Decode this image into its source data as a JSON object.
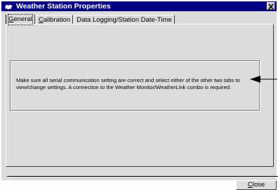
{
  "window": {
    "title": "Weather Station Properties",
    "title_icon": "weather-station-icon",
    "close_glyph": "✕"
  },
  "tabs": [
    {
      "label_first": "G",
      "label_rest": "eneral",
      "active": true
    },
    {
      "label_first": "C",
      "label_rest": "alibration",
      "active": false
    },
    {
      "label_first": "",
      "label_rest": "Data Logging/Station Date-Time",
      "active": false
    }
  ],
  "general": {
    "message": "Make sure all serial communication setting are correct and select either of the other two tabs to view/change settings. A connection to the Weather Monitor/WeatherLink combo is required."
  },
  "footer": {
    "close_first": "C",
    "close_rest": "lose"
  },
  "colors": {
    "titlebar": "#000080",
    "face": "#dcdcdc"
  }
}
